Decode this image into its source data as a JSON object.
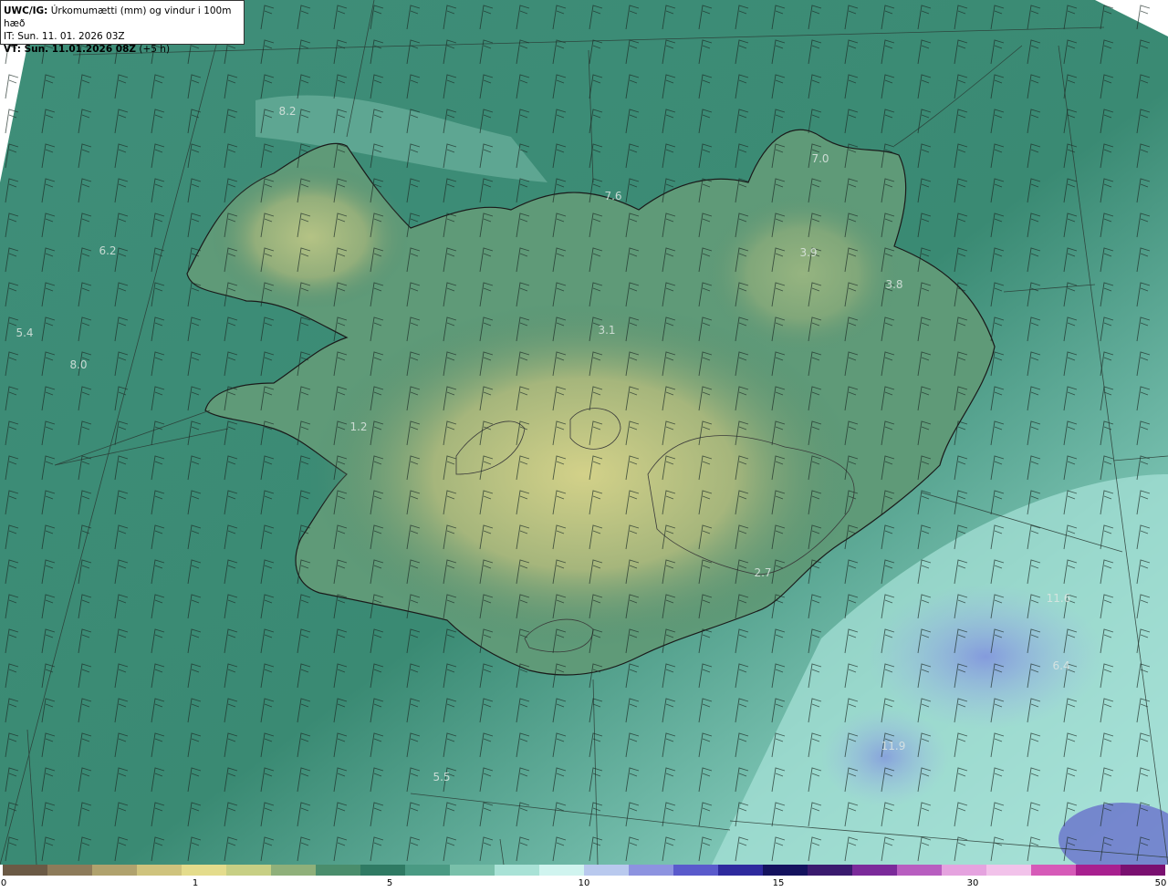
{
  "header": {
    "product": "UWC/IG:",
    "title": "Úrkomumætti (mm) og vindur i 100m hæð",
    "init_time": "IT: Sun. 11. 01. 2026 03Z",
    "valid_label": "VT: Sun. 11.01.2026 08Z",
    "valid_offset": "(+5 h)"
  },
  "map_labels": [
    {
      "text": "8.2"
    },
    {
      "text": "7.0"
    },
    {
      "text": "7.6"
    },
    {
      "text": "6.2"
    },
    {
      "text": "3.9"
    },
    {
      "text": "3.8"
    },
    {
      "text": "5.4"
    },
    {
      "text": "3.1"
    },
    {
      "text": "8.0"
    },
    {
      "text": "1.2"
    },
    {
      "text": "2.7"
    },
    {
      "text": "11.6"
    },
    {
      "text": "6.4"
    },
    {
      "text": "11.9"
    },
    {
      "text": "5.5"
    }
  ],
  "colorbar": {
    "ticks": [
      "0",
      "1",
      "5",
      "10",
      "15",
      "30",
      "50"
    ],
    "colors": [
      "#6b5a45",
      "#8d7b5a",
      "#b0a26d",
      "#cfc37d",
      "#e4dc8c",
      "#c7cf84",
      "#8fb07a",
      "#4a8d6c",
      "#2f7a63",
      "#4a9a83",
      "#79c0aa",
      "#a9e2d6",
      "#d0f4ef",
      "#b9c9ee",
      "#8d93e0",
      "#5a5acc",
      "#2e2a9e",
      "#14125e",
      "#3a1a6e",
      "#7b2a9a",
      "#b85ec0",
      "#e5a3df",
      "#f2c2ea",
      "#d65ab8",
      "#a8208f",
      "#7a1070"
    ]
  }
}
